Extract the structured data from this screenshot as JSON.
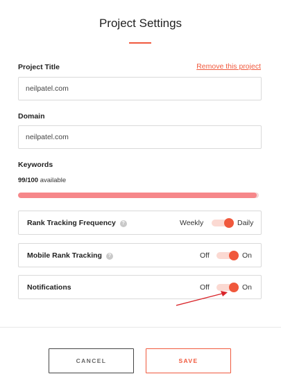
{
  "header": {
    "title": "Project Settings"
  },
  "project_title": {
    "label": "Project Title",
    "value": "neilpatel.com",
    "remove_link": "Remove this project"
  },
  "domain": {
    "label": "Domain",
    "value": "neilpatel.com"
  },
  "keywords": {
    "label": "Keywords",
    "used": "99/100",
    "suffix": "available",
    "progress_fraction": 0.99
  },
  "settings": {
    "rank_tracking": {
      "label": "Rank Tracking Frequency",
      "off_label": "Weekly",
      "on_label": "Daily",
      "value": "Daily"
    },
    "mobile_rank": {
      "label": "Mobile Rank Tracking",
      "off_label": "Off",
      "on_label": "On",
      "value": "On"
    },
    "notifications": {
      "label": "Notifications",
      "off_label": "Off",
      "on_label": "On",
      "value": "On"
    }
  },
  "actions": {
    "cancel_label": "CANCEL",
    "save_label": "SAVE"
  },
  "colors": {
    "accent": "#f0583c",
    "progress_fill": "#f6878a",
    "toggle_track": "#fbd9d2",
    "annotation_arrow": "#d9252a"
  },
  "annotation": {
    "type": "arrow",
    "points_to": "notifications-toggle"
  }
}
